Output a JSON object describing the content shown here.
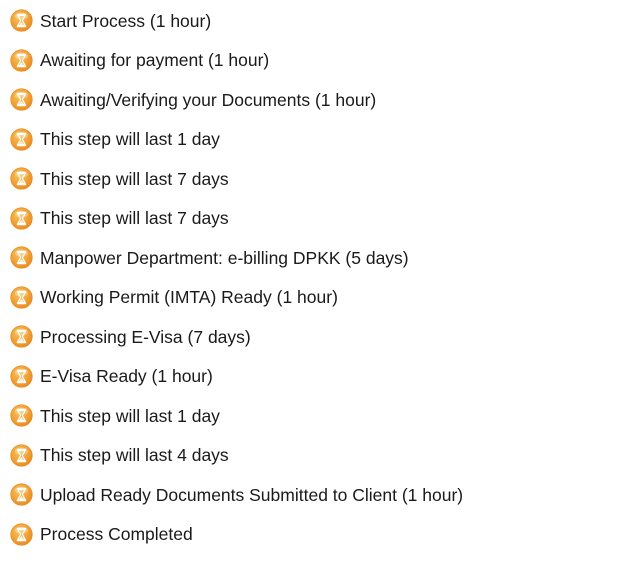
{
  "icon": "hourglass-icon",
  "colors": {
    "icon_outer": "#ea8a1f",
    "icon_inner": "#f7c45a",
    "hourglass": "#ffffff",
    "text": "#1a1a1a"
  },
  "steps": [
    {
      "label": "Start Process (1 hour)"
    },
    {
      "label": "Awaiting for payment (1 hour)"
    },
    {
      "label": "Awaiting/Verifying your Documents (1 hour)"
    },
    {
      "label": "This step will last 1 day"
    },
    {
      "label": "This step will last 7 days"
    },
    {
      "label": "This step will last 7 days"
    },
    {
      "label": "Manpower Department: e-billing DPKK (5 days)"
    },
    {
      "label": "Working Permit (IMTA) Ready (1 hour)"
    },
    {
      "label": "Processing E-Visa (7 days)"
    },
    {
      "label": "E-Visa Ready (1 hour)"
    },
    {
      "label": "This step will last 1 day"
    },
    {
      "label": "This step will last 4 days"
    },
    {
      "label": "Upload Ready Documents Submitted to Client (1 hour)"
    },
    {
      "label": "Process Completed"
    }
  ]
}
